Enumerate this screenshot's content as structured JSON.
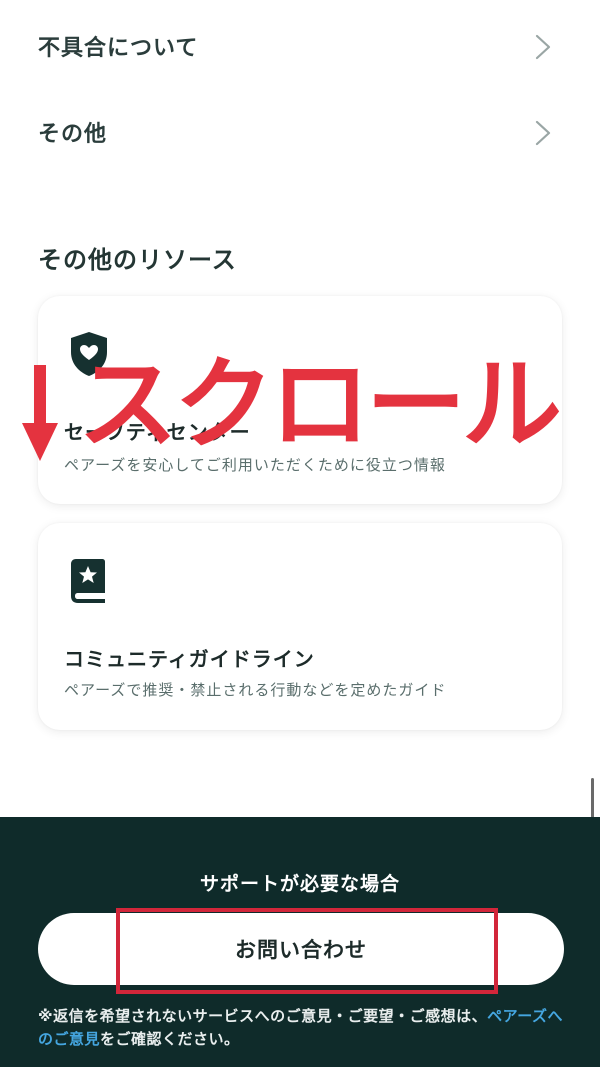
{
  "menu": {
    "items": [
      {
        "label": "不具合について"
      },
      {
        "label": "その他"
      }
    ]
  },
  "resources": {
    "title": "その他のリソース",
    "cards": [
      {
        "icon": "shield-heart-icon",
        "title": "セーフティセンター",
        "description": "ペアーズを安心してご利用いただくために役立つ情報"
      },
      {
        "icon": "book-star-icon",
        "title": "コミュニティガイドライン",
        "description": "ペアーズで推奨・禁止される行動などを定めたガイド"
      }
    ]
  },
  "annotation": {
    "text": "スクロール",
    "color": "#e4333f"
  },
  "support": {
    "heading": "サポートが必要な場合",
    "button_label": "お問い合わせ",
    "note_prefix": "※返信を希望されないサービスへのご意見・ご要望・ご感想は、",
    "note_link": "ペアーズへのご意見",
    "note_suffix": "をご確認ください。",
    "background_color": "#0f2b2a",
    "link_color": "#45a6e0"
  }
}
